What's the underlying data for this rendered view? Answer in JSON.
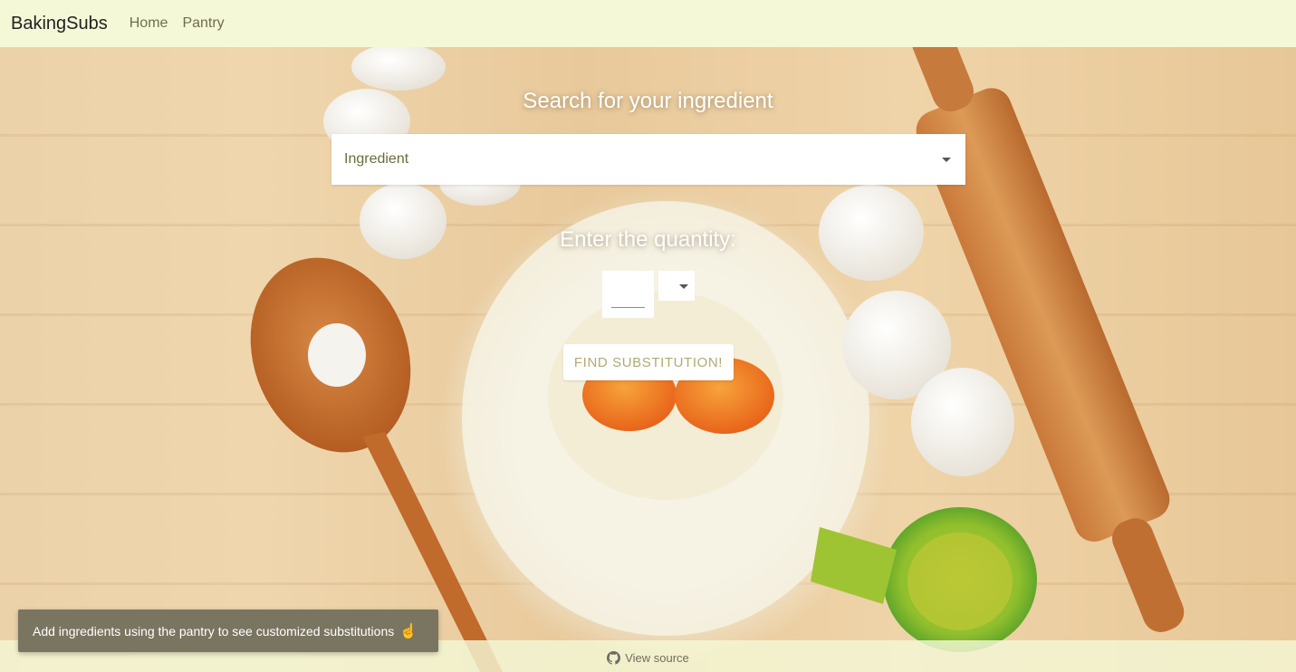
{
  "navbar": {
    "brand": "BakingSubs",
    "links": [
      "Home",
      "Pantry"
    ]
  },
  "search": {
    "heading": "Search for your ingredient",
    "ingredient_placeholder": "Ingredient"
  },
  "quantity": {
    "heading": "Enter the quantity:",
    "value": "",
    "unit": ""
  },
  "actions": {
    "find_label": "FIND SUBSTITUTION!"
  },
  "toast": {
    "message": "Add ingredients using the pantry to see customized substitutions",
    "icon": "pointing-hand-icon",
    "emoji": "☝"
  },
  "footer": {
    "view_source": "View source",
    "icon": "github-icon"
  },
  "colors": {
    "navbar_bg": "#f4f8d6",
    "toast_bg": "#7a7560",
    "button_text": "#b0aa72"
  }
}
